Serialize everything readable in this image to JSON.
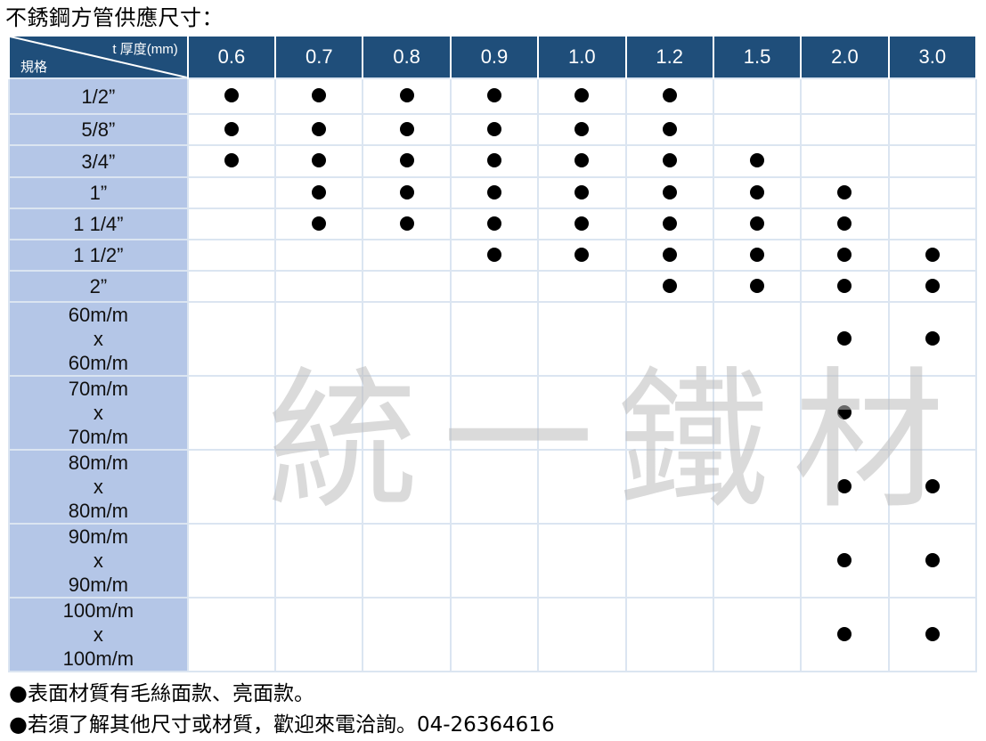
{
  "title": "不銹鋼方管供應尺寸：",
  "header": {
    "corner_top": "t 厚度(mm)",
    "corner_bottom": "規格",
    "thickness": [
      "0.6",
      "0.7",
      "0.8",
      "0.9",
      "1.0",
      "1.2",
      "1.5",
      "2.0",
      "3.0"
    ]
  },
  "rows": [
    {
      "label": [
        "1/2”"
      ],
      "avail": [
        1,
        1,
        1,
        1,
        1,
        1,
        0,
        0,
        0
      ]
    },
    {
      "label": [
        "5/8”"
      ],
      "avail": [
        1,
        1,
        1,
        1,
        1,
        1,
        0,
        0,
        0
      ]
    },
    {
      "label": [
        "3/4”"
      ],
      "avail": [
        1,
        1,
        1,
        1,
        1,
        1,
        1,
        0,
        0
      ]
    },
    {
      "label": [
        "1”"
      ],
      "avail": [
        0,
        1,
        1,
        1,
        1,
        1,
        1,
        1,
        0
      ]
    },
    {
      "label": [
        "1 1/4”"
      ],
      "avail": [
        0,
        1,
        1,
        1,
        1,
        1,
        1,
        1,
        0
      ]
    },
    {
      "label": [
        "1 1/2”"
      ],
      "avail": [
        0,
        0,
        0,
        1,
        1,
        1,
        1,
        1,
        1
      ]
    },
    {
      "label": [
        "2”"
      ],
      "avail": [
        0,
        0,
        0,
        0,
        0,
        1,
        1,
        1,
        1
      ]
    },
    {
      "label": [
        "60m/m",
        "x",
        "60m/m"
      ],
      "avail": [
        0,
        0,
        0,
        0,
        0,
        0,
        0,
        1,
        1
      ]
    },
    {
      "label": [
        "70m/m",
        "x",
        "70m/m"
      ],
      "avail": [
        0,
        0,
        0,
        0,
        0,
        0,
        0,
        1,
        0
      ]
    },
    {
      "label": [
        "80m/m",
        "x",
        "80m/m"
      ],
      "avail": [
        0,
        0,
        0,
        0,
        0,
        0,
        0,
        1,
        1
      ]
    },
    {
      "label": [
        "90m/m",
        "x",
        "90m/m"
      ],
      "avail": [
        0,
        0,
        0,
        0,
        0,
        0,
        0,
        1,
        1
      ]
    },
    {
      "label": [
        "100m/m",
        "x",
        "100m/m"
      ],
      "avail": [
        0,
        0,
        0,
        0,
        0,
        0,
        0,
        1,
        1
      ]
    }
  ],
  "watermark": [
    "統",
    "一",
    "鐵",
    "材"
  ],
  "notes": [
    {
      "bullet": "●",
      "text": "表面材質有毛絲面款、亮面款。"
    },
    {
      "bullet": "●",
      "text": "若須了解其他尺寸或材質，歡迎來電洽詢。04-26364616"
    }
  ],
  "colors": {
    "header_bg": "#1f4e7a",
    "row_label_bg": "#b4c6e7",
    "grid": "#dbe5f1"
  }
}
